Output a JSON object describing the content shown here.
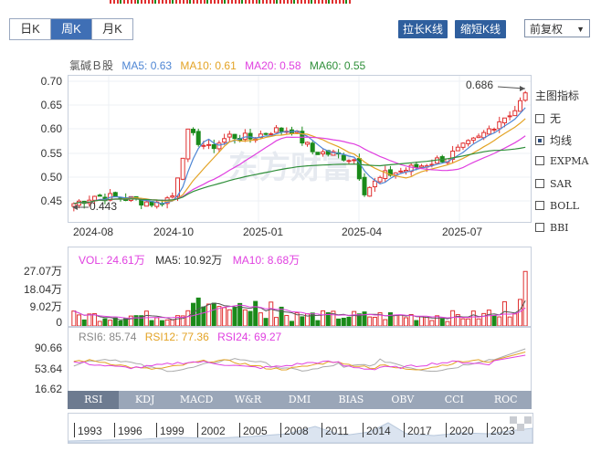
{
  "period_tabs": [
    {
      "label": "日K",
      "active": false
    },
    {
      "label": "周K",
      "active": true
    },
    {
      "label": "月K",
      "active": false
    }
  ],
  "toolbar": {
    "stretch_label": "拉长K线",
    "shrink_label": "缩短K线",
    "adjust_label": "前复权"
  },
  "legend": {
    "name": "氯碱Ｂ股",
    "ma5": "MA5: 0.63",
    "ma10": "MA10: 0.61",
    "ma20": "MA20: 0.58",
    "ma60": "MA60: 0.55"
  },
  "price_axis": {
    "ticks": [
      "0.70",
      "0.65",
      "0.60",
      "0.55",
      "0.50",
      "0.45"
    ]
  },
  "date_axis": {
    "ticks": [
      "2024-08",
      "2024-10",
      "2025-01",
      "2025-04",
      "2025-07"
    ]
  },
  "annotations": {
    "high": "0.686",
    "low": "0.443"
  },
  "indicator_panel": {
    "title": "主图指标",
    "options": [
      {
        "label": "无",
        "checked": false
      },
      {
        "label": "均线",
        "checked": true
      },
      {
        "label": "EXPMA",
        "checked": false
      },
      {
        "label": "SAR",
        "checked": false
      },
      {
        "label": "BOLL",
        "checked": false
      },
      {
        "label": "BBI",
        "checked": false
      }
    ]
  },
  "volume_legend": {
    "vol": "VOL: 24.61万",
    "ma5": "MA5: 10.92万",
    "ma10": "MA10: 8.68万"
  },
  "volume_axis": {
    "ticks": [
      "27.07万",
      "18.04万",
      "9.02万",
      "0"
    ]
  },
  "rsi_legend": {
    "rsi6": "RSI6: 85.74",
    "rsi12": "RSI12: 77.36",
    "rsi24": "RSI24: 69.27"
  },
  "rsi_axis": {
    "ticks": [
      "90.66",
      "53.64",
      "16.62"
    ]
  },
  "indicator_tabs": [
    {
      "label": "RSI",
      "active": true
    },
    {
      "label": "KDJ",
      "active": false
    },
    {
      "label": "MACD",
      "active": false
    },
    {
      "label": "W&R",
      "active": false
    },
    {
      "label": "DMI",
      "active": false
    },
    {
      "label": "BIAS",
      "active": false
    },
    {
      "label": "OBV",
      "active": false
    },
    {
      "label": "CCI",
      "active": false
    },
    {
      "label": "ROC",
      "active": false
    }
  ],
  "timeline": {
    "years": [
      "1993",
      "1996",
      "1999",
      "2002",
      "2005",
      "2008",
      "2011",
      "2014",
      "2017",
      "2020",
      "2023"
    ]
  },
  "colors": {
    "up": "#e03030",
    "down": "#1a8a1a",
    "ma5": "#4e86d4",
    "ma10": "#e3a325",
    "ma20": "#e040e0",
    "ma60": "#2f8f3a",
    "tab_active": "#3f6fb5"
  }
}
